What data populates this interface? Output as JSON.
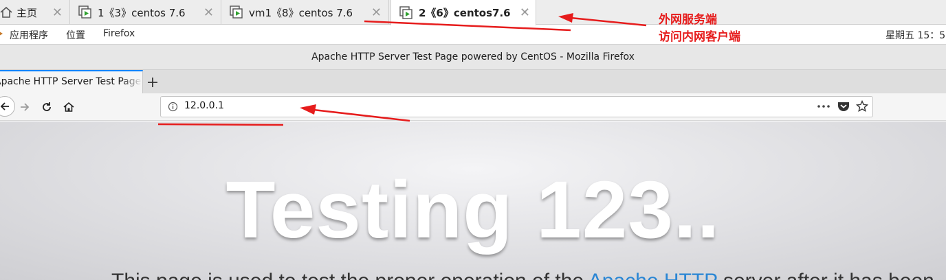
{
  "vm_tabs": [
    {
      "label": "主页"
    },
    {
      "label": "1《3》centos 7.6"
    },
    {
      "label": "vm1《8》centos 7.6"
    },
    {
      "label": "2《6》centos7.6",
      "active": true
    }
  ],
  "gnome": {
    "applications": "应用程序",
    "places": "位置",
    "firefox": "Firefox",
    "clock": "星期五 15：5"
  },
  "firefox": {
    "window_title": "Apache HTTP Server Test Page powered by CentOS - Mozilla Firefox",
    "tab_title": "Apache HTTP Server Test Page powered by CentOS",
    "url": "12.0.0.1"
  },
  "page": {
    "hero": "Testing 123..",
    "sub_text": "This page is used to test the proper operation of the ",
    "sub_link": "Apache HTTP",
    "sub_tail": " server after it has been"
  },
  "annotation": {
    "line1": "外网服务端",
    "line2": "访问内网客户端",
    "color": "#e61c1c"
  }
}
